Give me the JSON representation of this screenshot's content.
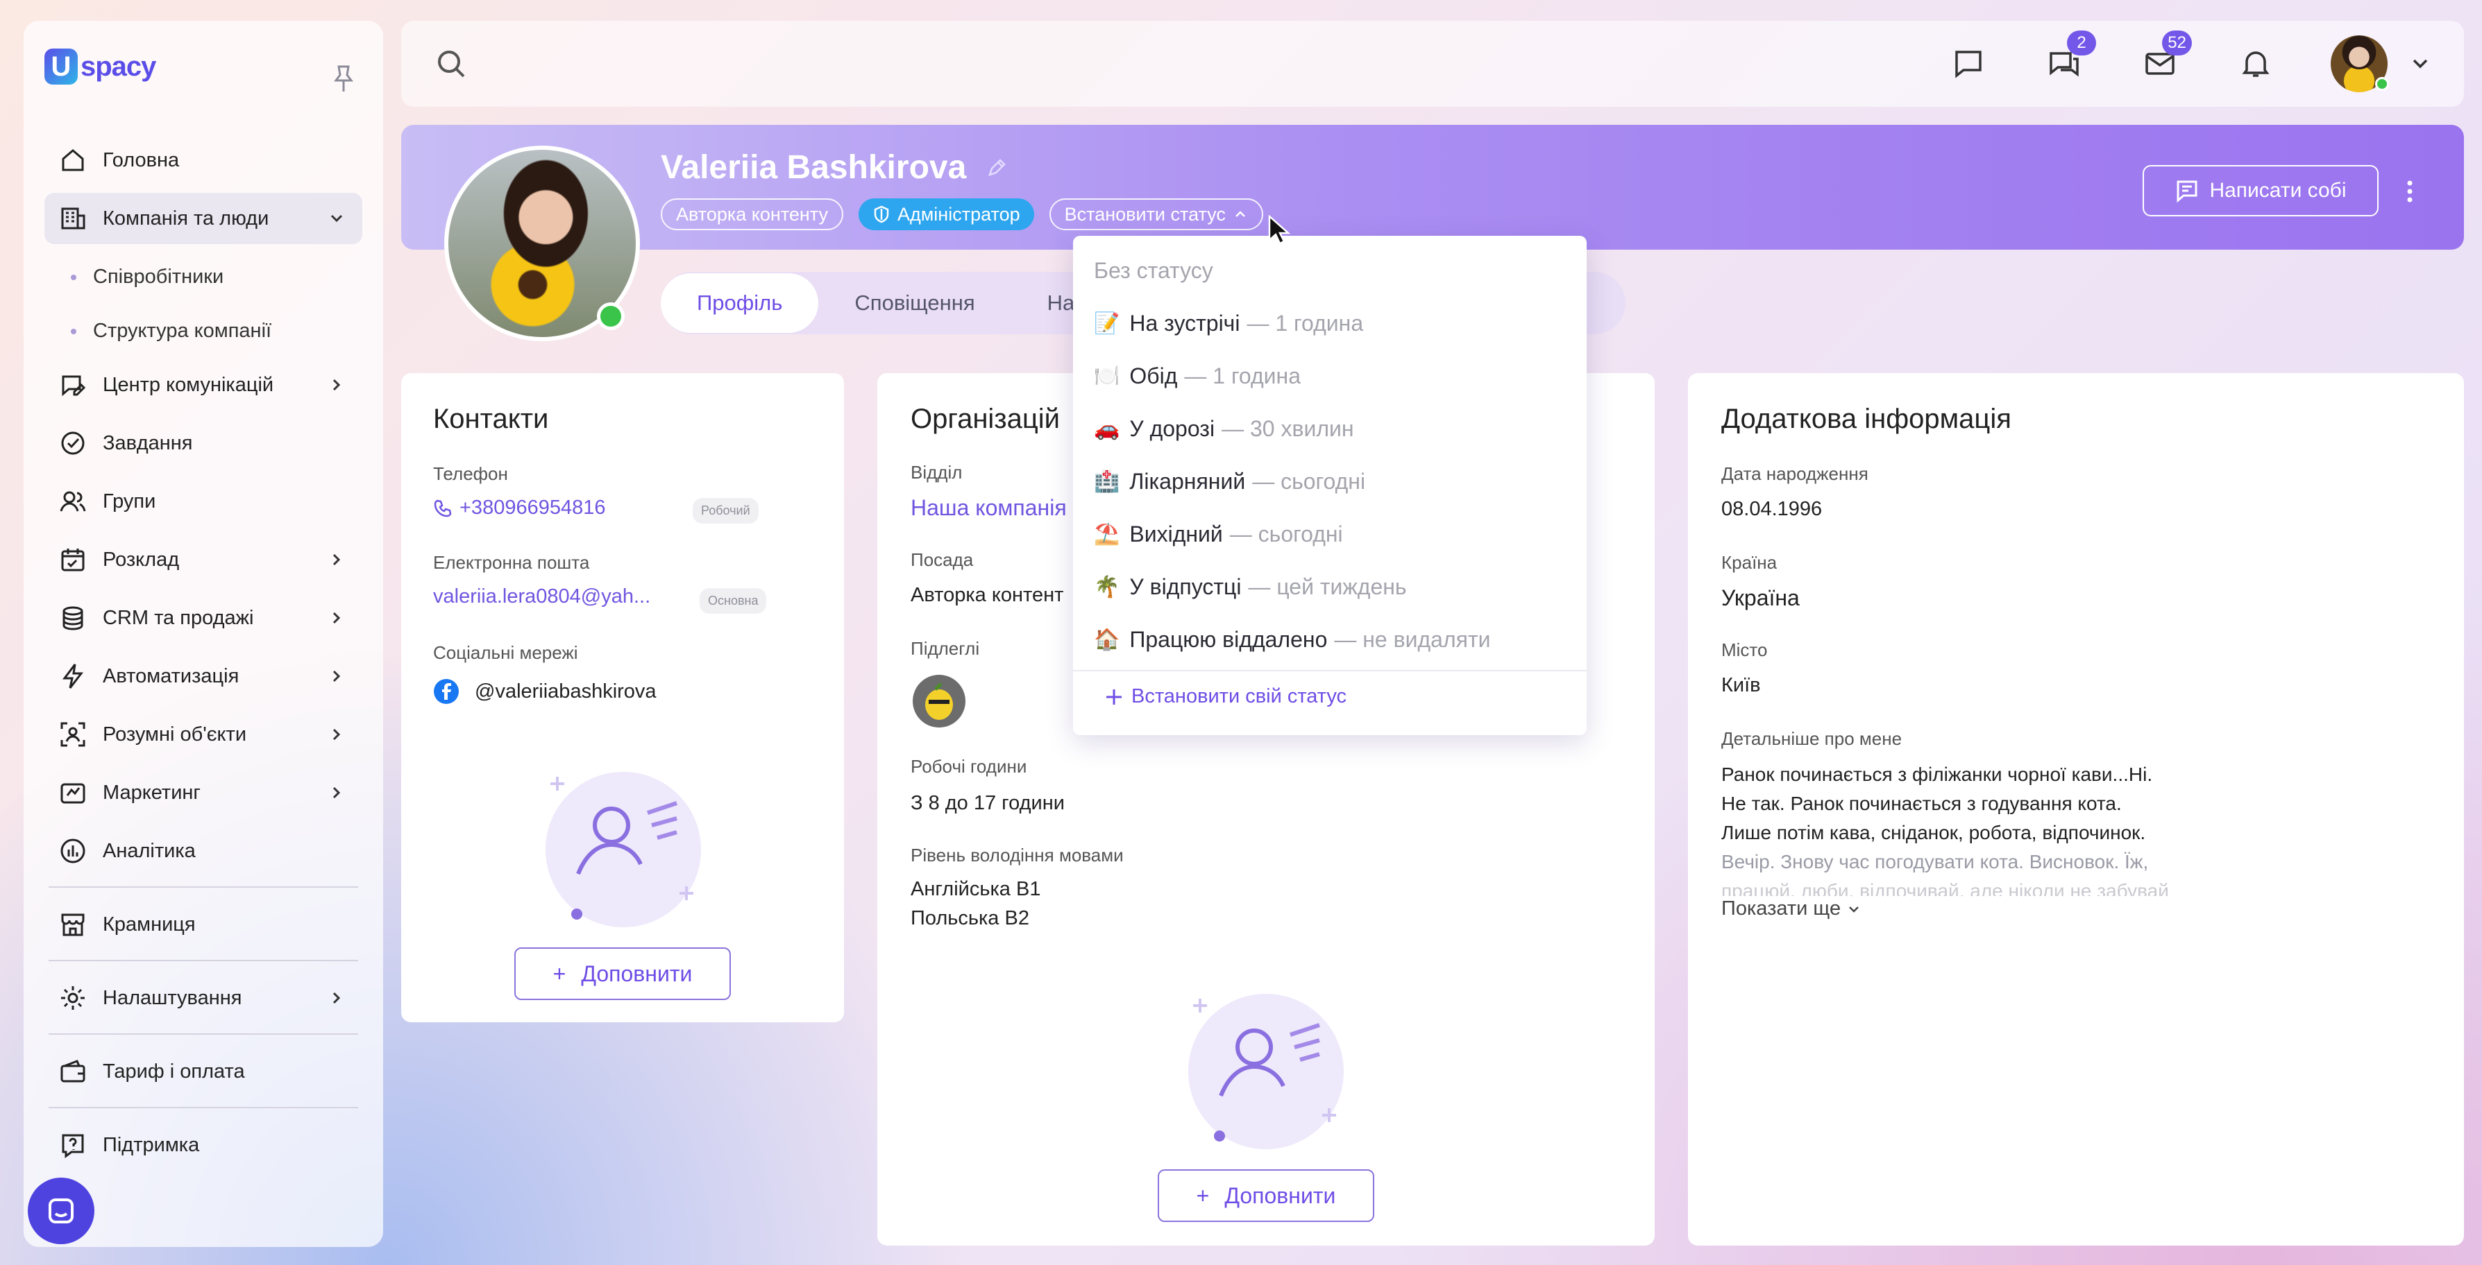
{
  "app": {
    "logo_text": "spacy",
    "logo_mark": "U"
  },
  "sidebar": {
    "items": [
      {
        "label": "Головна",
        "icon": "home-icon"
      },
      {
        "label": "Компанія та люди",
        "icon": "building-icon",
        "expanded": true
      },
      {
        "label": "Співробітники",
        "sub": true
      },
      {
        "label": "Структура компанії",
        "sub": true
      },
      {
        "label": "Центр комунікацій",
        "icon": "chat-edit-icon",
        "has_children": true
      },
      {
        "label": "Завдання",
        "icon": "check-circle-icon"
      },
      {
        "label": "Групи",
        "icon": "users-icon"
      },
      {
        "label": "Розклад",
        "icon": "calendar-icon",
        "has_children": true
      },
      {
        "label": "CRM та продажі",
        "icon": "coins-icon",
        "has_children": true
      },
      {
        "label": "Автоматизація",
        "icon": "lightning-icon",
        "has_children": true
      },
      {
        "label": "Розумні об'єкти",
        "icon": "scan-user-icon",
        "has_children": true
      },
      {
        "label": "Маркетинг",
        "icon": "megaphone-icon",
        "has_children": true
      },
      {
        "label": "Аналітика",
        "icon": "chart-pie-icon"
      },
      {
        "label": "Крамниця",
        "icon": "store-icon"
      },
      {
        "label": "Налаштування",
        "icon": "gear-icon",
        "has_children": true
      },
      {
        "label": "Тариф і оплата",
        "icon": "wallet-icon"
      },
      {
        "label": "Підтримка",
        "icon": "help-icon"
      }
    ]
  },
  "topbar": {
    "messages_badge": "2",
    "mail_badge": "52"
  },
  "profile": {
    "name": "Valeriia Bashkirova",
    "tags": {
      "role": "Авторка контенту",
      "admin": "Адміністратор",
      "status": "Встановити статус"
    },
    "write_self": "Написати собі",
    "tabs": [
      "Профіль",
      "Сповіщення",
      "Нала"
    ]
  },
  "contacts": {
    "title": "Контакти",
    "phone_label": "Телефон",
    "phone": "+380966954816",
    "phone_type": "Робочий",
    "email_label": "Електронна пошта",
    "email": "valeriia.lera0804@yah...",
    "email_type": "Основна",
    "social_label": "Соціальні мережі",
    "facebook": "@valeriiabashkirova",
    "fill": "Доповнити"
  },
  "organization": {
    "title": "Організацій",
    "department_label": "Відділ",
    "department": "Наша компанія",
    "position_label": "Посада",
    "position": "Авторка контент",
    "subordinates_label": "Підлеглі",
    "hours_label": "Робочі години",
    "hours": "З 8 до 17 години",
    "language_label": "Рівень володіння мовами",
    "language_1": "Англійська B1",
    "language_2": "Польська B2",
    "fill": "Доповнити"
  },
  "additional": {
    "title": "Додаткова інформація",
    "birth_label": "Дата народження",
    "birth": "08.04.1996",
    "country_label": "Країна",
    "country": "Україна",
    "city_label": "Місто",
    "city": "Київ",
    "about_label": "Детальніше про мене",
    "about_1": "Ранок починається з філіжанки чорної кави...Ні.",
    "about_2": "Не так. Ранок починається з годування кота.",
    "about_3": "Лише потім кава, сніданок, робота, відпочинок.",
    "about_4": "Вечір. Знову час погодувати кота. Висновок. Їж,",
    "about_5": "працюй, люби, відпочивай, але ніколи не забувай",
    "show_more": "Показати ще"
  },
  "status_menu": {
    "none": "Без статусу",
    "items": [
      {
        "emoji": "📝",
        "label": "На зустрічі",
        "duration": "— 1 година"
      },
      {
        "emoji": "🍽️",
        "label": "Обід",
        "duration": "— 1 година"
      },
      {
        "emoji": "🚗",
        "label": "У дорозі",
        "duration": "— 30 хвилин"
      },
      {
        "emoji": "🏥",
        "label": "Лікарняний",
        "duration": "— сьогодні"
      },
      {
        "emoji": "⛱️",
        "label": "Вихідний",
        "duration": "— сьогодні"
      },
      {
        "emoji": "🌴",
        "label": "У відпустці",
        "duration": "— цей тиждень"
      },
      {
        "emoji": "🏠",
        "label": "Працюю віддалено",
        "duration": "— не видаляти"
      }
    ],
    "custom": "Встановити свій статус"
  }
}
